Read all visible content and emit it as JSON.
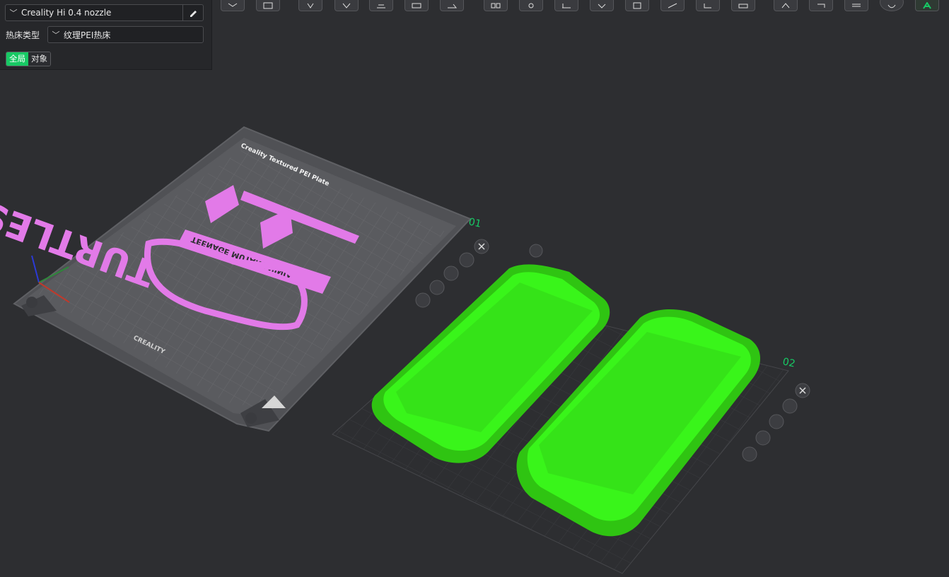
{
  "printer": {
    "selected": "Creality Hi 0.4 nozzle",
    "edit_icon": "pencil-icon"
  },
  "bed_type": {
    "label": "热床类型",
    "selected": "纹理PEI热床"
  },
  "scope_tabs": [
    {
      "label": "全局",
      "active": true
    },
    {
      "label": "对象",
      "active": false
    }
  ],
  "plate_1": {
    "number": "01",
    "title": "Creality Textured PEI Plate",
    "brand": "CREALITY",
    "model_text_main": "TURTLES",
    "model_text_sub": "TEENAGE MUTANT NINJA"
  },
  "plate_2": {
    "number": "02"
  },
  "plate_tool_icons": [
    "close-icon",
    "arrange-icon",
    "orient-icon",
    "lock-icon",
    "settings-icon"
  ],
  "toolbar_icons": [
    "view-cube-icon",
    "grid-icon",
    "add-icon",
    "shape-icon",
    "slice-plate-icon",
    "arrange-icon",
    "orient-icon",
    "split-icon",
    "settings-icon",
    "measure-icon",
    "cube-icon",
    "text-icon",
    "paint-icon",
    "cut-icon",
    "ruler-icon",
    "support-icon",
    "seam-icon",
    "layers-icon",
    "sphere-icon",
    "assembly-icon"
  ],
  "colors": {
    "accent": "#17c964",
    "model_pink": "#e27ae8",
    "model_green": "#39f51a",
    "background": "#2d2e31"
  }
}
